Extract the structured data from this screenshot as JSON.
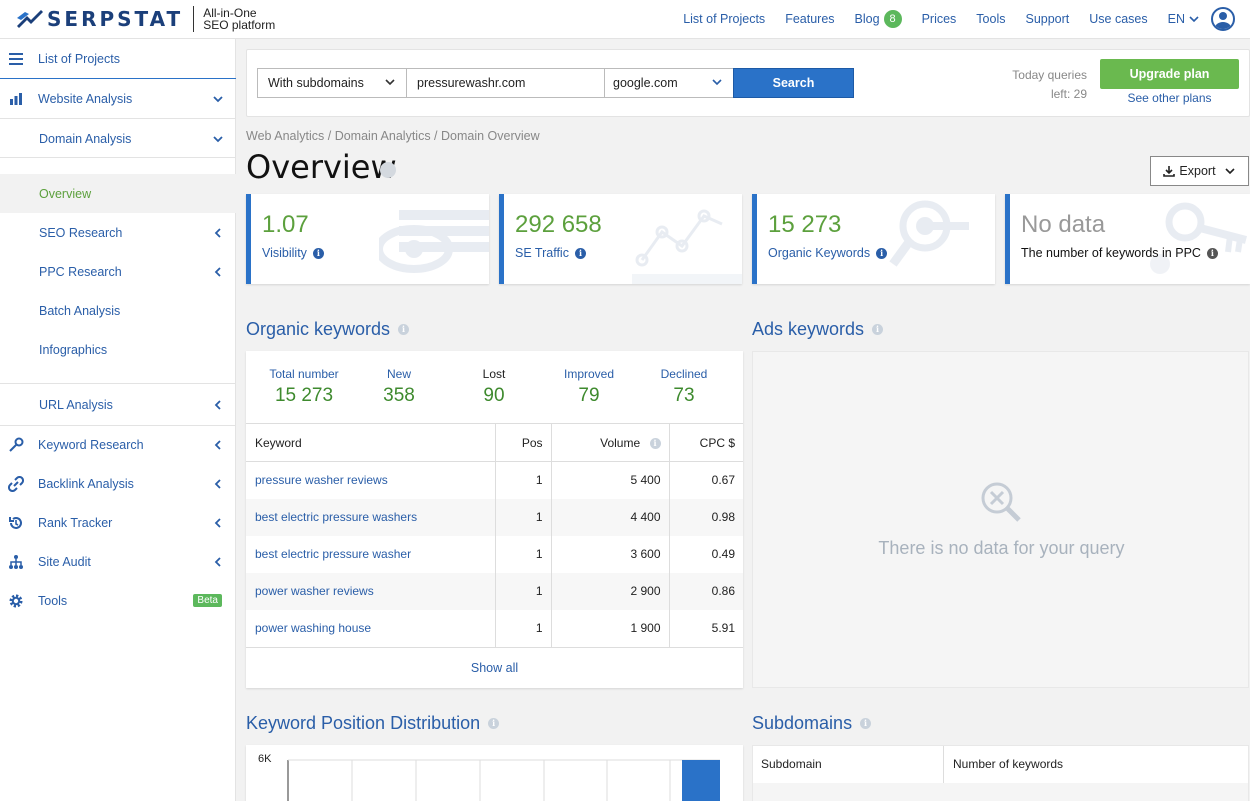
{
  "brand": {
    "name": "SERPSTAT",
    "tagline_1": "All-in-One",
    "tagline_2": "SEO platform"
  },
  "topnav": {
    "items": [
      "List of Projects",
      "Features",
      "Blog",
      "Prices",
      "Tools",
      "Support",
      "Use cases"
    ],
    "blog_badge": "8",
    "language": "EN"
  },
  "sidebar": {
    "list_of_projects": "List of Projects",
    "website_analysis": "Website Analysis",
    "domain_analysis": "Domain Analysis",
    "overview": "Overview",
    "seo_research": "SEO Research",
    "ppc_research": "PPC Research",
    "batch_analysis": "Batch Analysis",
    "infographics": "Infographics",
    "url_analysis": "URL Analysis",
    "keyword_research": "Keyword Research",
    "backlink_analysis": "Backlink Analysis",
    "rank_tracker": "Rank Tracker",
    "site_audit": "Site Audit",
    "tools": "Tools",
    "tools_badge": "Beta"
  },
  "search": {
    "scope": "With subdomains",
    "domain": "pressurewashr.com",
    "engine": "google.com",
    "button": "Search",
    "queries_label": "Today queries",
    "queries_left": "left: 29",
    "upgrade": "Upgrade plan",
    "see_plans": "See other plans"
  },
  "breadcrumb": "Web Analytics / Domain Analytics / Domain Overview",
  "page_title": "Overview",
  "export_label": "Export",
  "cards": [
    {
      "value": "1.07",
      "label": "Visibility"
    },
    {
      "value": "292 658",
      "label": "SE Traffic"
    },
    {
      "value": "15 273",
      "label": "Organic Keywords"
    },
    {
      "value": "No data",
      "label": "The number of keywords in PPC"
    }
  ],
  "organic": {
    "title": "Organic keywords",
    "stats": [
      {
        "label": "Total number",
        "value": "15 273"
      },
      {
        "label": "New",
        "value": "358"
      },
      {
        "label": "Lost",
        "value": "90"
      },
      {
        "label": "Improved",
        "value": "79"
      },
      {
        "label": "Declined",
        "value": "73"
      }
    ],
    "columns": [
      "Keyword",
      "Pos",
      "Volume",
      "CPC $"
    ],
    "rows": [
      {
        "keyword": "pressure washer reviews",
        "pos": "1",
        "volume": "5 400",
        "cpc": "0.67"
      },
      {
        "keyword": "best electric pressure washers",
        "pos": "1",
        "volume": "4 400",
        "cpc": "0.98"
      },
      {
        "keyword": "best electric pressure washer",
        "pos": "1",
        "volume": "3 600",
        "cpc": "0.49"
      },
      {
        "keyword": "power washer reviews",
        "pos": "1",
        "volume": "2 900",
        "cpc": "0.86"
      },
      {
        "keyword": "power washing house",
        "pos": "1",
        "volume": "1 900",
        "cpc": "5.91"
      }
    ],
    "show_all": "Show all"
  },
  "ads": {
    "title": "Ads keywords",
    "empty": "There is no data for your query"
  },
  "kpd": {
    "title": "Keyword Position Distribution",
    "y_tick": "6K"
  },
  "subdomains": {
    "title": "Subdomains",
    "columns": [
      "Subdomain",
      "Number of keywords"
    ]
  }
}
